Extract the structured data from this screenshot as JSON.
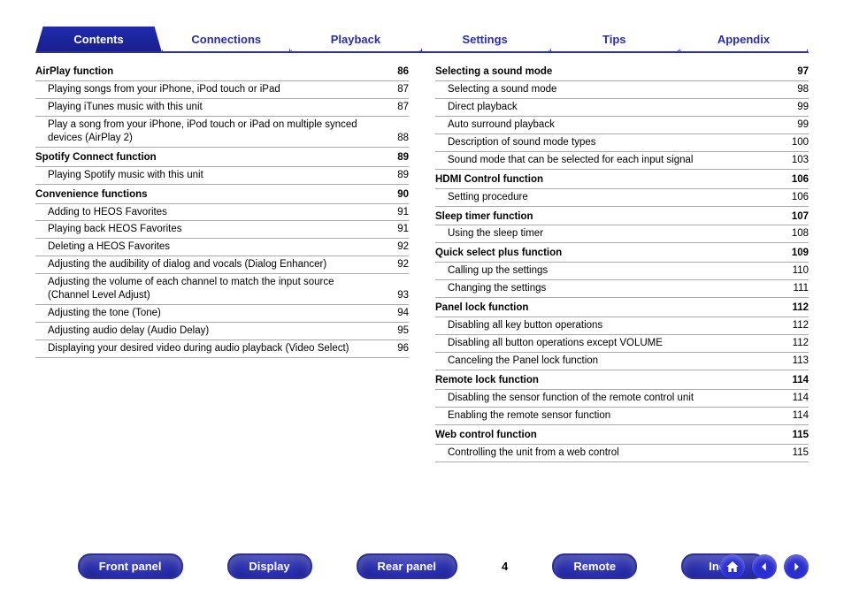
{
  "tabs": [
    "Contents",
    "Connections",
    "Playback",
    "Settings",
    "Tips",
    "Appendix"
  ],
  "activeTab": 0,
  "pageNumber": "4",
  "leftCol": [
    {
      "heading": true,
      "t": "AirPlay function",
      "p": "86"
    },
    {
      "heading": false,
      "t": "Playing songs from your iPhone, iPod touch or iPad",
      "p": "87"
    },
    {
      "heading": false,
      "t": "Playing iTunes music with this unit",
      "p": "87"
    },
    {
      "heading": false,
      "t": "Play a song from your iPhone, iPod touch or iPad on multiple synced devices (AirPlay 2)",
      "p": "88"
    },
    {
      "heading": true,
      "t": "Spotify Connect function",
      "p": "89"
    },
    {
      "heading": false,
      "t": "Playing Spotify music with this unit",
      "p": "89"
    },
    {
      "heading": true,
      "t": "Convenience functions",
      "p": "90"
    },
    {
      "heading": false,
      "t": "Adding to HEOS Favorites",
      "p": "91"
    },
    {
      "heading": false,
      "t": "Playing back HEOS Favorites",
      "p": "91"
    },
    {
      "heading": false,
      "t": "Deleting a HEOS Favorites",
      "p": "92"
    },
    {
      "heading": false,
      "t": "Adjusting the audibility of dialog and vocals (Dialog Enhancer)",
      "p": "92"
    },
    {
      "heading": false,
      "t": "Adjusting the volume of each channel to match the input source (Channel Level Adjust)",
      "p": "93"
    },
    {
      "heading": false,
      "t": "Adjusting the tone (Tone)",
      "p": "94"
    },
    {
      "heading": false,
      "t": "Adjusting audio delay (Audio Delay)",
      "p": "95"
    },
    {
      "heading": false,
      "t": "Displaying your desired video during audio playback (Video Select)",
      "p": "96"
    }
  ],
  "rightCol": [
    {
      "heading": true,
      "t": "Selecting a sound mode",
      "p": "97"
    },
    {
      "heading": false,
      "t": "Selecting a sound mode",
      "p": "98"
    },
    {
      "heading": false,
      "t": "Direct playback",
      "p": "99"
    },
    {
      "heading": false,
      "t": "Auto surround playback",
      "p": "99"
    },
    {
      "heading": false,
      "t": "Description of sound mode types",
      "p": "100"
    },
    {
      "heading": false,
      "t": "Sound mode that can be selected for each input signal",
      "p": "103"
    },
    {
      "heading": true,
      "t": "HDMI Control function",
      "p": "106"
    },
    {
      "heading": false,
      "t": "Setting procedure",
      "p": "106"
    },
    {
      "heading": true,
      "t": "Sleep timer function",
      "p": "107"
    },
    {
      "heading": false,
      "t": "Using the sleep timer",
      "p": "108"
    },
    {
      "heading": true,
      "t": "Quick select plus function",
      "p": "109"
    },
    {
      "heading": false,
      "t": "Calling up the settings",
      "p": "110"
    },
    {
      "heading": false,
      "t": "Changing the settings",
      "p": "111"
    },
    {
      "heading": true,
      "t": "Panel lock function",
      "p": "112"
    },
    {
      "heading": false,
      "t": "Disabling all key button operations",
      "p": "112"
    },
    {
      "heading": false,
      "t": "Disabling all button operations except VOLUME",
      "p": "112"
    },
    {
      "heading": false,
      "t": "Canceling the Panel lock function",
      "p": "113"
    },
    {
      "heading": true,
      "t": "Remote lock function",
      "p": "114"
    },
    {
      "heading": false,
      "t": "Disabling the sensor function of the remote control unit",
      "p": "114"
    },
    {
      "heading": false,
      "t": "Enabling the remote sensor function",
      "p": "114"
    },
    {
      "heading": true,
      "t": "Web control function",
      "p": "115"
    },
    {
      "heading": false,
      "t": "Controlling the unit from a web control",
      "p": "115"
    }
  ],
  "bottomButtons": [
    "Front panel",
    "Display",
    "Rear panel",
    "Remote",
    "Index"
  ]
}
